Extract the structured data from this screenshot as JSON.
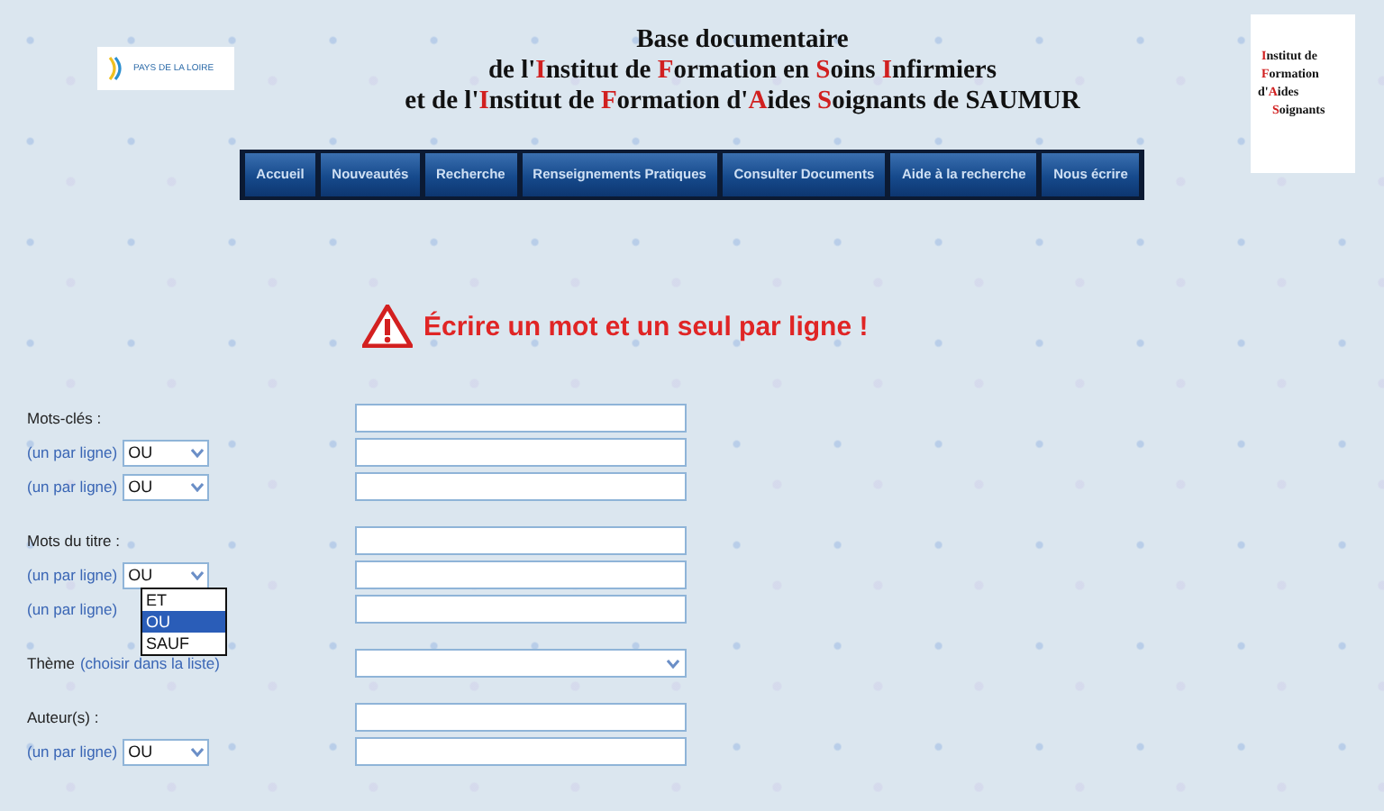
{
  "header": {
    "left_logo": {
      "text": "PAYS DE LA LOIRE"
    },
    "title_lines": [
      [
        {
          "text": "Base documentaire",
          "initial": false
        }
      ],
      [
        {
          "text": "de l'",
          "initial": false
        },
        {
          "text": "I",
          "initial": true
        },
        {
          "text": "nstitut de ",
          "initial": false
        },
        {
          "text": "F",
          "initial": true
        },
        {
          "text": "ormation en ",
          "initial": false
        },
        {
          "text": "S",
          "initial": true
        },
        {
          "text": "oins ",
          "initial": false
        },
        {
          "text": "I",
          "initial": true
        },
        {
          "text": "nfirmiers",
          "initial": false
        }
      ],
      [
        {
          "text": "et de l'",
          "initial": false
        },
        {
          "text": "I",
          "initial": true
        },
        {
          "text": "nstitut de ",
          "initial": false
        },
        {
          "text": "F",
          "initial": true
        },
        {
          "text": "ormation d'",
          "initial": false
        },
        {
          "text": "A",
          "initial": true
        },
        {
          "text": "ides ",
          "initial": false
        },
        {
          "text": "S",
          "initial": true
        },
        {
          "text": "oignants de SAUMUR",
          "initial": false
        }
      ]
    ],
    "right_logo": [
      [
        {
          "text": "I",
          "initial": true
        },
        {
          "text": "nstitut de",
          "initial": false
        }
      ],
      [
        {
          "text": "F",
          "initial": true
        },
        {
          "text": "ormation",
          "initial": false
        }
      ],
      [
        {
          "text": "d'",
          "initial": false
        },
        {
          "text": "A",
          "initial": true
        },
        {
          "text": "ides",
          "initial": false
        }
      ],
      [
        {
          "text": "S",
          "initial": true
        },
        {
          "text": "oignants",
          "initial": false
        }
      ]
    ]
  },
  "nav": [
    "Accueil",
    "Nouveautés",
    "Recherche",
    "Renseignements Pratiques",
    "Consulter Documents",
    "Aide à la recherche",
    "Nous écrire"
  ],
  "warning": {
    "message": "Écrire un mot et un seul par ligne !"
  },
  "form": {
    "groups": [
      {
        "rows": [
          {
            "kind": "field",
            "label": "Mots-clés :"
          },
          {
            "kind": "operator",
            "hint": "(un par ligne)",
            "operator": "OU"
          },
          {
            "kind": "operator",
            "hint": "(un par ligne)",
            "operator": "OU"
          }
        ]
      },
      {
        "rows": [
          {
            "kind": "field",
            "label": "Mots du titre :"
          },
          {
            "kind": "operator",
            "hint": "(un par ligne)",
            "operator": "OU",
            "expanded": true,
            "options": [
              {
                "label": "ET",
                "selected": false
              },
              {
                "label": "OU",
                "selected": true
              },
              {
                "label": "SAUF",
                "selected": false
              }
            ]
          },
          {
            "kind": "operator",
            "hint": "(un par ligne)"
          }
        ]
      },
      {
        "rows": [
          {
            "kind": "list",
            "label": "Thème",
            "hint": "(choisir dans la liste)"
          }
        ]
      },
      {
        "rows": [
          {
            "kind": "field",
            "label": "Auteur(s) :"
          },
          {
            "kind": "operator",
            "hint": "(un par ligne)",
            "operator": "OU"
          }
        ]
      }
    ]
  }
}
